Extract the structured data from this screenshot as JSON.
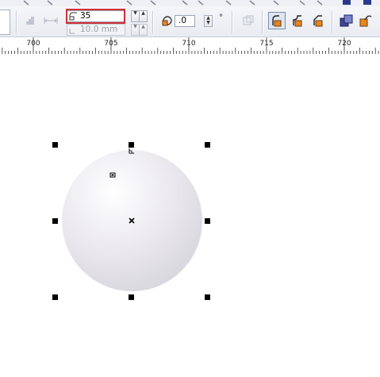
{
  "toolbar": {
    "corner_radius_value": "35",
    "corner_radius_icon": "corner-radius-icon",
    "scale_value": "10.0 mm",
    "rotation_value": ".0",
    "rotation_unit": "°"
  },
  "ruler": {
    "labels": [
      "700",
      "705",
      "710",
      "715",
      "720"
    ]
  },
  "colors": {
    "selection_box": "#d0303a",
    "active_button": "#dfe6f2",
    "icon_orange": "#e8861f",
    "icon_blue": "#5a5fb0"
  }
}
